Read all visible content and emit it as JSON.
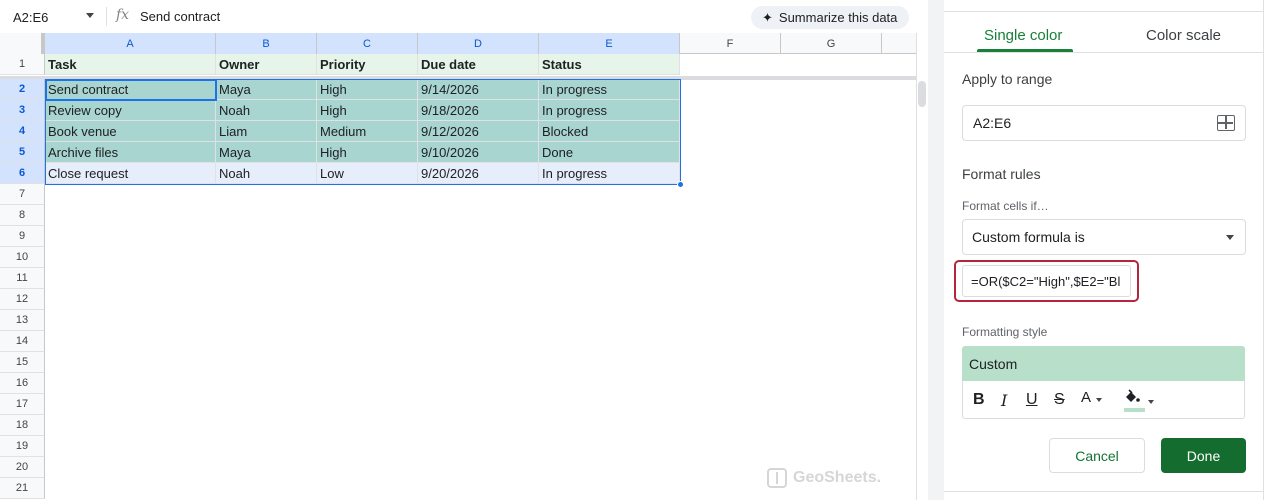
{
  "toolbar": {
    "name_box": "A2:E6",
    "fx_label": "fx",
    "formula_value": "Send contract",
    "summarize_label": "Summarize this data",
    "summarize_icon": "sparkle-icon"
  },
  "sheet": {
    "columns": [
      "A",
      "B",
      "C",
      "D",
      "E",
      "F",
      "G"
    ],
    "rows": [
      "1",
      "2",
      "3",
      "4",
      "5",
      "6",
      "7",
      "8",
      "9",
      "10",
      "11",
      "12",
      "13",
      "14",
      "15",
      "16",
      "17",
      "18",
      "19",
      "20",
      "21"
    ],
    "header": [
      "Task",
      "Owner",
      "Priority",
      "Due date",
      "Status"
    ],
    "data": [
      [
        "Send contract",
        "Maya",
        "High",
        "9/14/2026",
        "In progress"
      ],
      [
        "Review copy",
        "Noah",
        "High",
        "9/18/2026",
        "In progress"
      ],
      [
        "Book venue",
        "Liam",
        "Medium",
        "9/12/2026",
        "Blocked"
      ],
      [
        "Archive files",
        "Maya",
        "High",
        "9/10/2026",
        "Done"
      ],
      [
        "Close request",
        "Noah",
        "Low",
        "9/20/2026",
        "In progress"
      ]
    ],
    "highlight_color": "#a8d5cf",
    "selection_color": "#1a73e8",
    "watermark": "GeoSheets."
  },
  "panel": {
    "tabs": [
      "Single color",
      "Color scale"
    ],
    "active_tab": "Single color",
    "apply_label": "Apply to range",
    "range_value": "A2:E6",
    "format_rules_label": "Format rules",
    "format_cells_if_label": "Format cells if…",
    "condition_value": "Custom formula is",
    "formula_value": "=OR($C2=\"High\",$E2=\"Bl",
    "formatting_style_label": "Formatting style",
    "style_preview": "Custom",
    "style_buttons": [
      "B",
      "I",
      "U",
      "S",
      "A"
    ],
    "fill_color": "#b7dfc9",
    "cancel_label": "Cancel",
    "done_label": "Done",
    "accent_color": "#188038"
  }
}
